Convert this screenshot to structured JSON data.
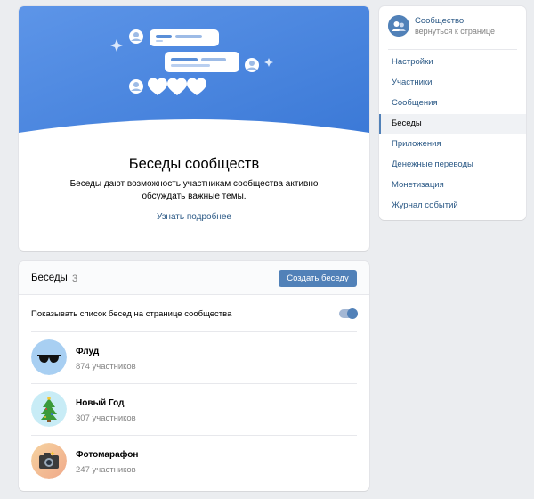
{
  "promo": {
    "title": "Беседы сообществ",
    "description": "Беседы дают возможность участникам сообщества активно обсуждать важные темы.",
    "learn_more": "Узнать подробнее"
  },
  "chats": {
    "title": "Беседы",
    "count": "3",
    "create_label": "Создать беседу",
    "toggle_label": "Показывать список бесед на странице сообщества",
    "toggle_on": true,
    "items": [
      {
        "name": "Флуд",
        "members": "874 участников",
        "icon": "sunglasses-icon"
      },
      {
        "name": "Новый Год",
        "members": "307 участников",
        "icon": "christmas-tree-icon"
      },
      {
        "name": "Фотомарафон",
        "members": "247 участников",
        "icon": "camera-icon"
      }
    ]
  },
  "menu": {
    "community_name": "Сообщество",
    "community_back": "вернуться к странице",
    "items": [
      {
        "label": "Настройки",
        "active": false
      },
      {
        "label": "Участники",
        "active": false
      },
      {
        "label": "Сообщения",
        "active": false
      },
      {
        "label": "Беседы",
        "active": true
      },
      {
        "label": "Приложения",
        "active": false
      },
      {
        "label": "Денежные переводы",
        "active": false
      },
      {
        "label": "Монетизация",
        "active": false
      },
      {
        "label": "Журнал событий",
        "active": false
      }
    ]
  },
  "colors": {
    "accent": "#5181b8",
    "link": "#2a5885",
    "background": "#ebedf0",
    "muted": "#828282"
  }
}
